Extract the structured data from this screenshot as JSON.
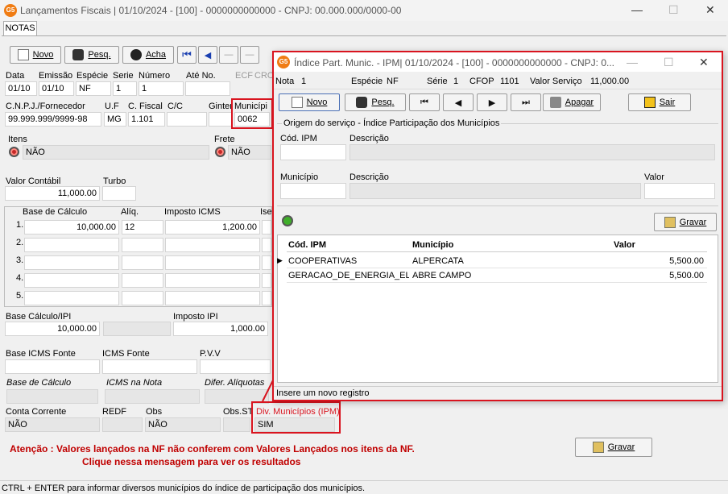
{
  "main_window": {
    "title": "Lançamentos Fiscais |  01/10/2024 - [100] - 0000000000000 - CNPJ: 00.000.000/0000-00",
    "tab": "NOTAS",
    "toolbar": {
      "novo": "Novo",
      "pesq": "Pesq.",
      "acha": "Acha"
    },
    "fields": {
      "data_label": "Data",
      "data": "01/10",
      "emissao_label": "Emissão",
      "emissao": "01/10",
      "especie_label": "Espécie",
      "especie": "NF",
      "serie_label": "Serie",
      "serie": "1",
      "numero_label": "Número",
      "numero": "1",
      "ate_no_label": "Até No.",
      "ecf_label": "ECF",
      "crc_label": "CRO",
      "cnpj_label": "C.N.P.J./Fornecedor",
      "cnpj": "99.999.999/9999-98",
      "uf_label": "U.F",
      "uf": "MG",
      "cfiscal_label": "C. Fiscal",
      "cfiscal": "1.101",
      "cc_label": "C/C",
      "ginter_label": "Ginter",
      "municipio_label": "Municípi",
      "municipio": "0062",
      "itens_label": "Itens",
      "itens": "NÃO",
      "frete_label": "Frete",
      "frete": "NÃO",
      "valor_contabil_label": "Valor Contábil",
      "valor_contabil": "11,000.00",
      "turbo_label": "Turbo",
      "base_calculo_label": "Base de Cálculo",
      "aliq_label": "Alíq.",
      "imposto_icms_label": "Imposto ICMS",
      "ise_label": "Ise",
      "base_ipi_label": "Base Cálculo/IPI",
      "base_ipi": "10,000.00",
      "imposto_ipi_label": "Imposto IPI",
      "imposto_ipi": "1,000.00",
      "base_icms_fonte_label": "Base ICMS Fonte",
      "icms_fonte_label": "ICMS Fonte",
      "pvv_label": "P.V.V",
      "base_calc_it_label": "Base de Cálculo",
      "icms_nota_label": "ICMS na Nota",
      "difer_label": "Difer. Alíquotas",
      "conta_corrente_label": "Conta Corrente",
      "conta_corrente": "NÃO",
      "redf_label": "REDF",
      "obs_label": "Obs",
      "obs": "NÃO",
      "obs_st_label": "Obs.ST",
      "div_municipios_label": "Div. Municípios (IPM)",
      "div_municipios": "SIM"
    },
    "icms_rows": [
      {
        "n": "1.",
        "base": "10,000.00",
        "aliq": "12",
        "imposto": "1,200.00"
      },
      {
        "n": "2.",
        "base": "",
        "aliq": "",
        "imposto": ""
      },
      {
        "n": "3.",
        "base": "",
        "aliq": "",
        "imposto": ""
      },
      {
        "n": "4.",
        "base": "",
        "aliq": "",
        "imposto": ""
      },
      {
        "n": "5.",
        "base": "",
        "aliq": "",
        "imposto": ""
      }
    ],
    "warning_line1": "Atenção : Valores lançados na NF não conferem com Valores Lançados nos itens da NF.",
    "warning_line2": "Clique nessa mensagem para ver os resultados",
    "gravar": "Gravar",
    "status_bar": "CTRL + ENTER para informar diversos municípios do índice de participação dos municípios."
  },
  "dialog": {
    "title": "Índice Part. Munic. - IPM|  01/10/2024 - [100] - 0000000000000 - CNPJ: 0...",
    "nota_label": "Nota",
    "nota": "1",
    "especie_label": "Espécie",
    "especie": "NF",
    "serie_label": "Série",
    "serie": "1",
    "cfop_label": "CFOP",
    "cfop": "1101",
    "valor_servico_label": "Valor Serviço",
    "valor_servico": "11,000.00",
    "buttons": {
      "novo": "Novo",
      "pesq": "Pesq.",
      "apagar": "Apagar",
      "sair": "Sair",
      "gravar": "Gravar"
    },
    "group_title": "Origem do serviço - Índice Participação dos Municípios",
    "cod_ipm_label": "Cód. IPM",
    "descricao_label": "Descrição",
    "municipio_label": "Município",
    "descricao2_label": "Descrição",
    "valor_label": "Valor",
    "grid_headers": [
      "Cód. IPM",
      "Município",
      "Valor"
    ],
    "grid_rows": [
      {
        "cod": "COOPERATIVAS",
        "municipio": "ALPERCATA",
        "valor": "5,500.00"
      },
      {
        "cod": "GERACAO_DE_ENERGIA_ELE",
        "municipio": "ABRE CAMPO",
        "valor": "5,500.00"
      }
    ],
    "status": "Insere um novo registro"
  },
  "colors": {
    "highlight": "#d9141f",
    "warning_text": "#c00000",
    "app_icon": "#f07c13"
  }
}
